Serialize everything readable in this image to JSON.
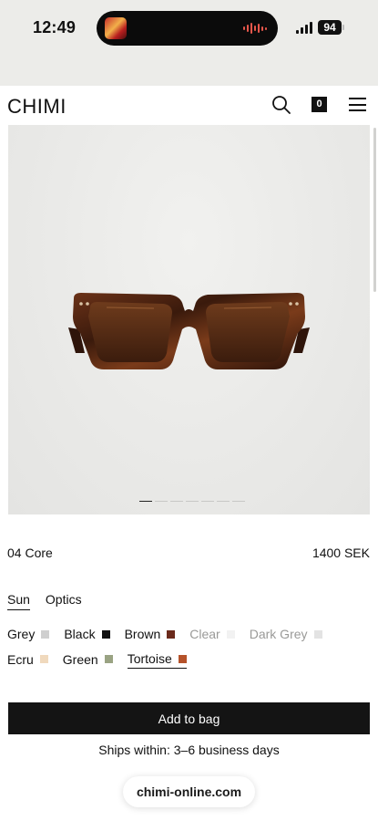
{
  "status_bar": {
    "time": "12:49",
    "battery": "94"
  },
  "header": {
    "logo": "CHIMI",
    "cart_count": "0"
  },
  "product": {
    "name": "04 Core",
    "price": "1400 SEK",
    "image_slides": 7,
    "active_slide": 1
  },
  "type_tabs": [
    {
      "label": "Sun",
      "active": true
    },
    {
      "label": "Optics",
      "active": false
    }
  ],
  "colors": [
    {
      "label": "Grey",
      "swatch": "#cfcfcf",
      "available": true,
      "selected": false
    },
    {
      "label": "Black",
      "swatch": "#111111",
      "available": true,
      "selected": false
    },
    {
      "label": "Brown",
      "swatch": "#6b2a1c",
      "available": true,
      "selected": false
    },
    {
      "label": "Clear",
      "swatch": "#f2f2f2",
      "available": false,
      "selected": false
    },
    {
      "label": "Dark Grey",
      "swatch": "#e3e3e3",
      "available": false,
      "selected": false
    },
    {
      "label": "Ecru",
      "swatch": "#f0d9bd",
      "available": true,
      "selected": false
    },
    {
      "label": "Green",
      "swatch": "#9aa383",
      "available": true,
      "selected": false
    },
    {
      "label": "Tortoise",
      "swatch": "#b5522a",
      "available": true,
      "selected": true
    }
  ],
  "cta": {
    "add_to_bag": "Add to bag"
  },
  "shipping": "Ships within: 3–6 business days",
  "browser": {
    "url": "chimi-online.com"
  },
  "icons": {
    "search": "search-icon",
    "cart": "cart-icon",
    "menu": "menu-icon"
  }
}
